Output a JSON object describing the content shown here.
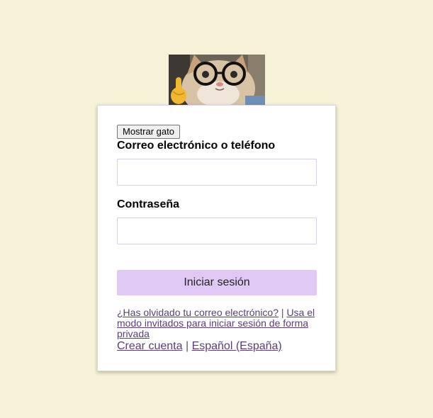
{
  "cat_image": {
    "alt": "gato con gafas"
  },
  "login": {
    "show_cat_label": "Mostrar gato",
    "email_label": "Correo electrónico o teléfono",
    "email_value": "",
    "password_label": "Contraseña",
    "password_value": "",
    "submit_label": "Iniciar sesión",
    "forgot_link": "¿Has olvidado tu correo electrónico?",
    "separator": "|",
    "guest_link": "Usa el modo invitados para iniciar sesión de forma privada",
    "create_account": "Crear cuenta",
    "language": "Español (España)"
  },
  "colors": {
    "background": "#f6f2d8",
    "card": "#ffffff",
    "button": "#e0c9f5",
    "link": "#5a3d7a"
  }
}
